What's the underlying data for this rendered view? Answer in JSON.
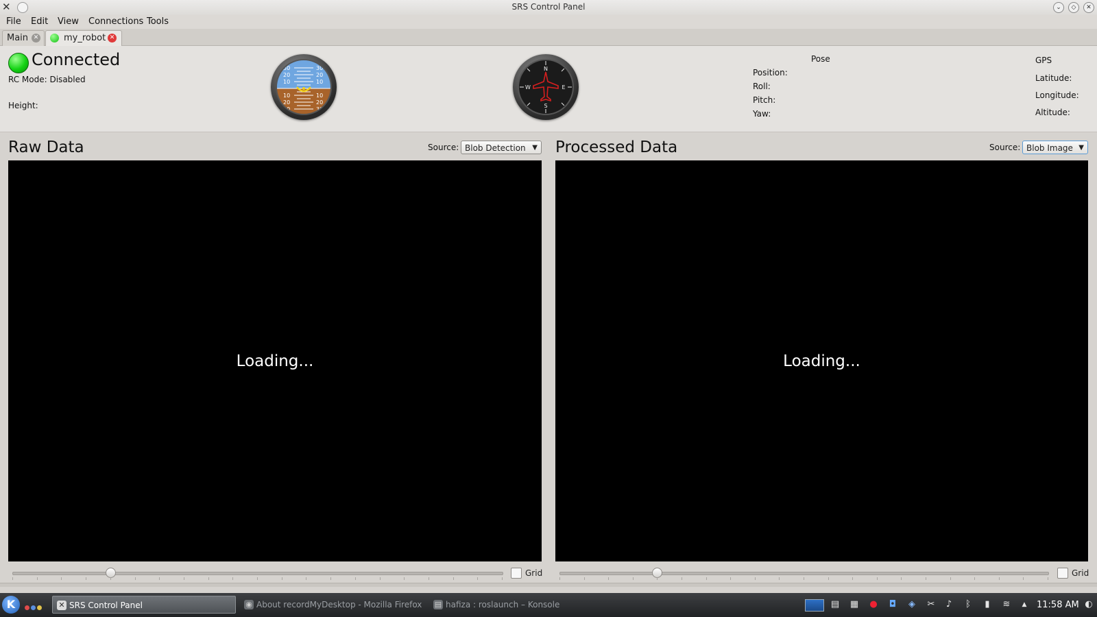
{
  "window": {
    "title": "SRS Control Panel",
    "buttons": [
      "minimize",
      "maximize",
      "close"
    ]
  },
  "menu": [
    "File",
    "Edit",
    "View",
    "Connections",
    "Tools"
  ],
  "tabs": [
    {
      "label": "Main",
      "active": false
    },
    {
      "label": "my_robot",
      "active": true
    }
  ],
  "status": {
    "connection": "Connected",
    "rc_mode": "RC Mode: Disabled",
    "height_label": "Height:"
  },
  "attitude_indicator": {
    "pitch_marks": [
      "30",
      "20",
      "10",
      "10",
      "20",
      "30"
    ],
    "colors": {
      "sky": "#6fa6e0",
      "ground": "#a8632a",
      "aircraft": "#f2d21b"
    }
  },
  "heading_indicator": {
    "cardinals": [
      "N",
      "E",
      "S",
      "W"
    ],
    "numbers": [
      "3",
      "6",
      "12",
      "15",
      "21",
      "24",
      "30",
      "33"
    ],
    "aircraft_color": "#d81f1f"
  },
  "pose": {
    "title": "Pose",
    "position": "Position:",
    "roll": "Roll:",
    "pitch": "Pitch:",
    "yaw": "Yaw:"
  },
  "gps": {
    "title": "GPS",
    "latitude": "Latitude:",
    "longitude": "Longitude:",
    "altitude": "Altitude:"
  },
  "raw": {
    "title": "Raw Data",
    "source_label": "Source:",
    "source_value": "Blob Detection",
    "loading": "Loading...",
    "grid_label": "Grid",
    "slider_fraction": 0.2
  },
  "processed": {
    "title": "Processed Data",
    "source_label": "Source:",
    "source_value": "Blob Image",
    "loading": "Loading...",
    "grid_label": "Grid",
    "slider_fraction": 0.2
  },
  "taskbar": {
    "tasks": [
      {
        "label": "SRS Control Panel",
        "active": true
      },
      {
        "label": "About recordMyDesktop - Mozilla Firefox",
        "active": false
      },
      {
        "label": "hafiza : roslaunch – Konsole",
        "active": false
      }
    ],
    "clock": "11:58 AM",
    "tray_icons": [
      "desktop-pager-icon",
      "notes-icon",
      "clipboard-icon",
      "record-icon",
      "network-manager-icon",
      "update-icon",
      "scissors-icon",
      "volume-icon",
      "bluetooth-icon",
      "battery-icon",
      "wifi-icon",
      "expand-tray-icon"
    ]
  }
}
